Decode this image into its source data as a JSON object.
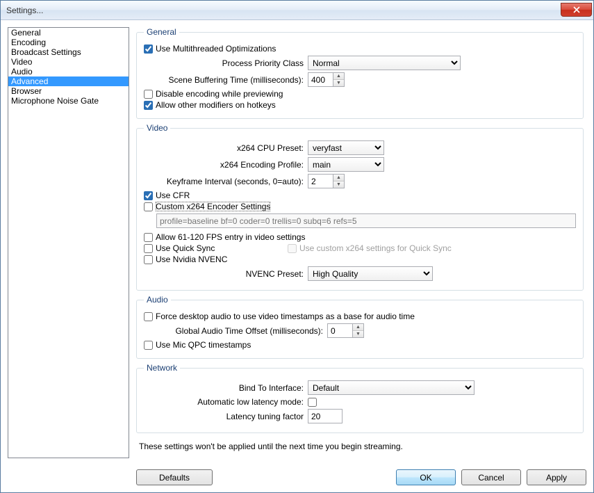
{
  "window": {
    "title": "Settings..."
  },
  "sidebar": {
    "items": [
      "General",
      "Encoding",
      "Broadcast Settings",
      "Video",
      "Audio",
      "Advanced",
      "Browser",
      "Microphone Noise Gate"
    ],
    "selected_index": 5
  },
  "groups": {
    "general": {
      "legend": "General",
      "multithreaded_label": "Use Multithreaded Optimizations",
      "multithreaded_checked": true,
      "priority_label": "Process Priority Class",
      "priority_value": "Normal",
      "scene_buffer_label": "Scene Buffering Time (milliseconds):",
      "scene_buffer_value": "400",
      "disable_encoding_label": "Disable encoding while previewing",
      "disable_encoding_checked": false,
      "allow_modifiers_label": "Allow other modifiers on hotkeys",
      "allow_modifiers_checked": true
    },
    "video": {
      "legend": "Video",
      "cpu_preset_label": "x264 CPU Preset:",
      "cpu_preset_value": "veryfast",
      "profile_label": "x264 Encoding Profile:",
      "profile_value": "main",
      "keyframe_label": "Keyframe Interval (seconds, 0=auto):",
      "keyframe_value": "2",
      "use_cfr_label": "Use CFR",
      "use_cfr_checked": true,
      "custom_x264_label": "Custom x264 Encoder Settings",
      "custom_x264_checked": false,
      "custom_x264_placeholder": "profile=baseline bf=0 coder=0 trellis=0 subq=6 refs=5",
      "allow_120_label": "Allow 61-120 FPS entry in video settings",
      "allow_120_checked": false,
      "quicksync_label": "Use Quick Sync",
      "quicksync_checked": false,
      "quicksync_custom_label": "Use custom x264 settings for Quick Sync",
      "quicksync_custom_checked": false,
      "nvenc_label": "Use Nvidia NVENC",
      "nvenc_checked": false,
      "nvenc_preset_label": "NVENC Preset:",
      "nvenc_preset_value": "High Quality"
    },
    "audio": {
      "legend": "Audio",
      "force_desktop_label": "Force desktop audio to use video timestamps as a base for audio time",
      "force_desktop_checked": false,
      "global_offset_label": "Global Audio Time Offset (milliseconds):",
      "global_offset_value": "0",
      "mic_qpc_label": "Use Mic QPC timestamps",
      "mic_qpc_checked": false
    },
    "network": {
      "legend": "Network",
      "bind_label": "Bind To Interface:",
      "bind_value": "Default",
      "auto_lat_label": "Automatic low latency mode:",
      "auto_lat_checked": false,
      "lat_factor_label": "Latency tuning factor",
      "lat_factor_value": "20"
    }
  },
  "note": "These settings won't be applied until the next time you begin streaming.",
  "buttons": {
    "defaults": "Defaults",
    "ok": "OK",
    "cancel": "Cancel",
    "apply": "Apply"
  }
}
